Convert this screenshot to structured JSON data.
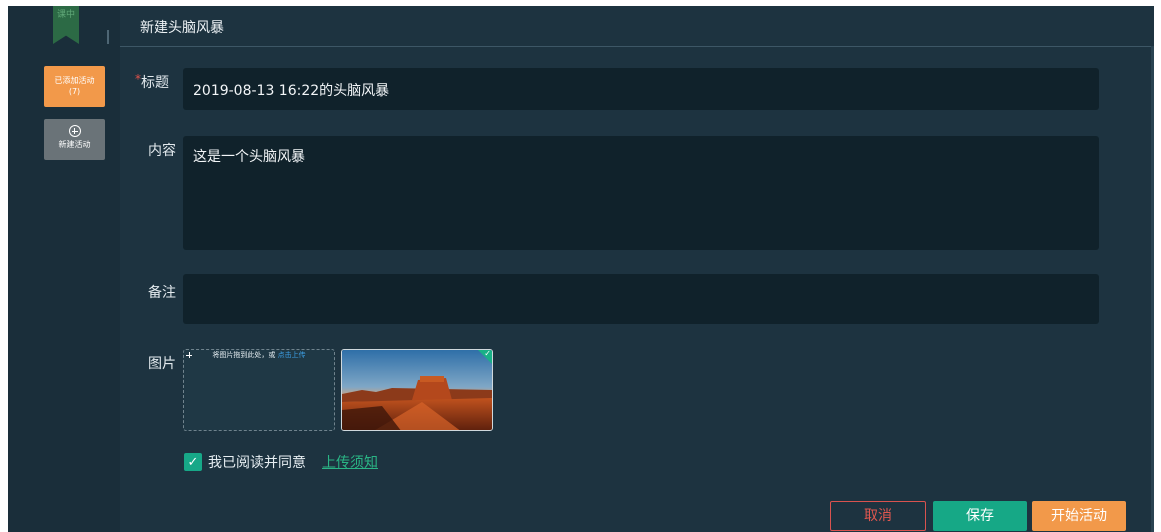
{
  "rail": {
    "bookmark_text": "课中",
    "added_tab_label": "已添加活动",
    "added_tab_count": "(7)",
    "new_tab_label": "新建活动"
  },
  "header": {
    "title": "新建头脑风暴"
  },
  "form": {
    "title_label": "标题",
    "title_required_mark": "*",
    "title_value": "2019-08-13 16:22的头脑风暴",
    "content_label": "内容",
    "content_value": "这是一个头脑风暴",
    "remark_label": "备注",
    "remark_value": "",
    "image_label": "图片",
    "upload_hint": "将图片拖到此处，或",
    "upload_link": "点击上传",
    "agree_text": "我已阅读并同意",
    "agree_checked": true,
    "notice_link": "上传须知"
  },
  "buttons": {
    "cancel": "取消",
    "save": "保存",
    "start": "开始活动"
  },
  "colors": {
    "accent_orange": "#f2994a",
    "accent_green": "#16a886",
    "cancel_red": "#e1574f",
    "panel_bg": "#1d3340",
    "field_bg": "#10222b"
  },
  "icons": {
    "new_tab": "plus-circle-icon",
    "upload": "plus-circle-icon",
    "checkbox": "check-icon",
    "thumb_selected": "check-icon"
  }
}
